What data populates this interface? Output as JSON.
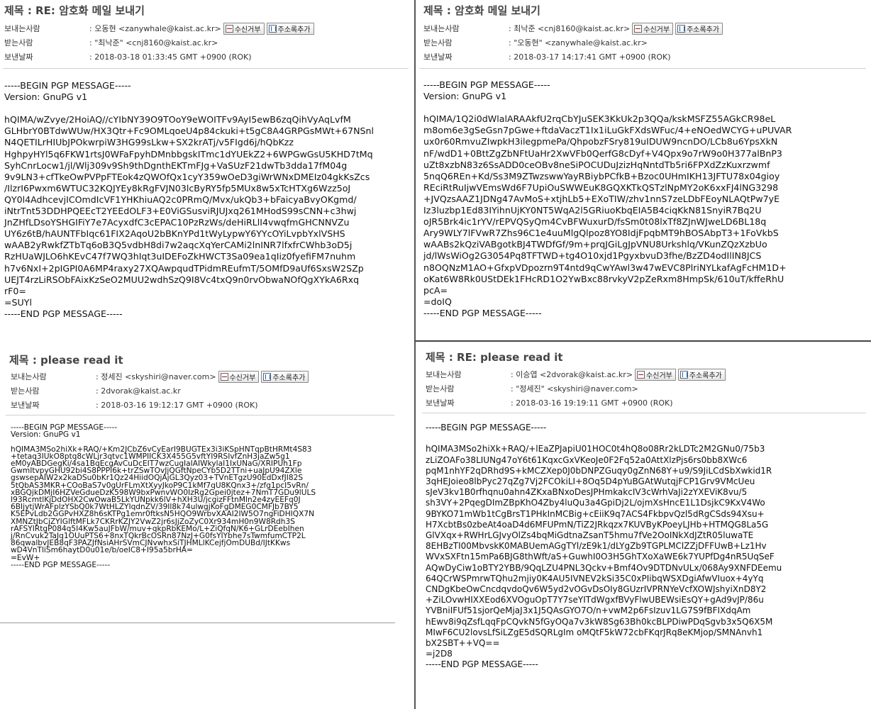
{
  "labels": {
    "subject": "제목 : ",
    "from": "보내는사람",
    "to": "받는사람",
    "date": "보낸날짜",
    "block_button": "수신거부",
    "addressbook_button": "주소록추가"
  },
  "messages": [
    {
      "subject": "RE: 암호화 메일 보내기",
      "from": ": 오동현 <zanywhale@kaist.ac.kr>",
      "to": ": \"최낙준\" <cnj8160@kaist.ac.kr>",
      "date": ": 2018-03-18 01:33:45 GMT +0900 (ROK)",
      "body": "-----BEGIN PGP MESSAGE-----\nVersion: GnuPG v1\n\nhQIMA/wZvye/2HoiAQ//cYIbNY39O9TOoY9eWOITFv9AyI5ewB6zqQihVyAqLvfM\nGLHbrY0BTdwWUw/HX3Qtr+Fc9OMLqoeU4p84ckuki+t5gC8A4GRPGsMWt+67NSnl\nN4QETILrHIUbJPOkwrpiW3HG99sLkw+SX2krATj/v5FIgd6j/hQbKzz\nHghpyHYl5q6FKW1rtsJ0WFaFpyhDMnbbgskITmc1dYUEkZ2+6WPGwGsU5KHD7tMq\nSyhCnrLocw1/jl/Wlj309v9Sh9thDgnthEKTmFJg+VaSUzF21dwTb3dda17fM04g\n9v9LN3+cfTkeOwPVPpFTEok4zQWOfQx1cyY359wOeD3giWrWNxDMEIz04gkKsZcs\n/IlzrI6Pwxm6WTUC32KQJYEy8kRgFVJN03lcByRY5fp5MUx8w5xTcHTXg6Wzz5oJ\nQY0l4AdhcevjICOmdIcVF1YHKhiuAQ2c0PRmQ/Mvx/ukQb3+bFaicyaBvyOKgmd/\niNtrTnt53DDHPQEEcT2YEEdOLF3+E0ViGSusviRJUJxq261MHodS99sCNN+c3hwj\nJnZHfLDsoYSHGIFiY7e7AcyxdfC3cEPAC10PzRzWs/deHiRLlI4vwqfmGHCNNVZu\nUY6z6tB/hAUNTFbIqc61FIX2AqoU2bBKnYPd1tWyLypwY6YYcOYiLvpbYxlVSHS\nwAAB2yRwkfZTbTq6oB3Q5vdbH8di7w2aqcXqYerCAMi2lnINR7lfxfrCWhb3oD5j\nRzHUaWJLO6hKEvC47f7WQ3hIqt3uIDEFoZkHWCT3Sa09ea1qIiz0fyefiFM7nuhm\nh7v6NxI+2pIGPI0A6MP4raxy27XQAwpqudTPidmREufmT/5OMfD9aUf6SxsW2SZp\nUEJT4rzLiRSObFAixKzSeO2MUU2wdhSzQ9I8Vc4txQ9n0rvObwaNOfQgXYkA6Rxq\nrF0=\n=SUYl\n-----END PGP MESSAGE-----"
    },
    {
      "subject": "암호화 메일 보내기",
      "from": ": 최낙준 <cnj8160@kaist.ac.kr>",
      "to": ": \"오동현\" <zanywhale@kaist.ac.kr>",
      "date": ": 2018-03-17 14:17:41 GMT +0900 (ROK)",
      "body": "-----BEGIN PGP MESSAGE-----\nVersion: GnuPG v1\n\nhQIMA/1Q2i0dWlalARAAkfU2rqCbYJuSEK3KkUk2p3QQa/kskMSFZ55AGkCR98eL\nm8om6e3gSeGsn7pGwe+ftdaVaczT1Ix1iLuGkFXdsWFuc/4+eNOedWCYG+uPUVAR\nux0r60RmvuZIwpkH3ilegpmePa/QhpobzFSry819uIDUW9ncnDO/LCb8u6YpsXkN\nnF/wdD1+0BttZgZbNFtUaHr2XwVFb0QerfG8cDyf+V4Qpx9o7rW9o0H377alBnP3\nuZt8xzbN83z6SsADD0ceOBv8neSiPOCUDuJzizHqNntdTb5ri6FPXdZzKuxrzwmf\n5nqQ6REn+Kd/Ss3M9ZTwzswwYayRBiybPCfkB+Bzoc0UHmIKH13JFTU78x04gioy\nREciRtRuIjwVEmsWd6F7UpiOuSWWEuK8GQXKTkQSTzlNpMY2oK6xxFJ4lNG3298\n+JVQzsAAZ1JDNg47AvMoS+xtjhLb5+EXoTIW/zhv1nnS7zeLDbFEoyNLAQtPw7yE\nIz3luzbp1Ed83IYihnUjKY0NT5WqA2l5GRiuoKbqEIA5B4ciqKkN81SnyiR7Bq2U\noJR5Brk4ic1rYV/rEPVQSyQm4CvBFWuxurD/fsSm0t08lxTf8ZJnWJweLD6BL18q\nAry9WLY7lFVwR7Zhs96C1e4uuMlgQlpoz8YO8IdjFpqbMT9hBOSAbpT3+1FoVkbS\nwAABs2kQziVABgotkBJ4TWDfGf/9m+prqJGiLgJpVNU8Urkshlq/VKunZQzXzbUo\njd/lWsWiOg2G3054Pq8TFTWD+tg4O10xjd1PgyxbvuD3fhe/BzZD4odIlIN8JCS\nn8OQNzM1AO+GfxpVDpozrn9T4ntd9qCwYAwl3w47wEVC8PlriNYLkafAgFcHM1D+\noKat6W8Rk0UStDEk1FHcRD1O2YwBxc88rvkyV2pZeRxm8HmpSk/610uT/kffeRhU\npcA=\n=doIQ\n-----END PGP MESSAGE-----"
    },
    {
      "subject": "please read it",
      "from": ": 정세진 <skyshiri@naver.com>",
      "to": ": 2dvorak@kaist.ac.kr",
      "date": ": 2018-03-16 19:12:17 GMT +0900 (ROK)",
      "body": "-----BEGIN PGP MESSAGE-----\nVersion: GnuPG v1\n\nhQIMA3MSo2hiXk+RAQ/+Km2JCbZ6vCyEarI9BUGTEx3i3iKSpHNTqpBtHRMt4S83\n+tetaq3IUkO8ptq8cWLjr3qtvc1WMPIICK3X455G5vftYI9RSIvfZnH3jaZw5g1\neM0yABDGegKi/4sa1BqEcgAvCuDcEIT7wzCugIaIAIWkylaI1IxUNaG/XRIPUh1Fp\nGwmItvpyGHU92bi4S8PPPI6k+trZSwTOvJjQGftNpeCYb5D2TTni+uaJpU94ZXle\ngswsepAIW2x2kaDSu0bKr1Qz24HiidOQjAjGL3Qyz03+TVnETgzU90EdDxfJI82S\n5tQbAS3MKR+COoBaS7v0gUrFLmXtXyyJkoP9C1kMf7qU8KQnx3+/zfg1pcI5vRn/\nxBGQjkDMjI6HZVeGdueDzK598W9bxPwnvWO0IzRg2Gpei0jtez+7NmT7GDu9lULS\nI93RcmtlKjDdOHX2CwOwaB5LkYUNpkk6lV+hXH3U/jcgizFFtnMln2e4zyEEFq0J\n6BIjytjWrAFplzYSbQ0k7WtHLZYIqdnZV/39Il8k74ulwgjKoFgDMEG0CMFJb7BY5\nK5EPvLdb2GGPvHXZ8h6sKTPg1emr0ftksN5HQO9WrbvXAAI2IW5O7ngFiDHIQX7N\nXMNZtJbCjZYIGlftMFLk7CKRrKZJY2VwZ2jr6sJjZoZyC0Xr934mH0n9W8Rdh3S\nrAFSYIRtgP084q5I4Kw5auJFbW/muv+qkpRbKEMo/L+ZiQfqN/K6+GLrDEebIhen\nj/RnCvuk2TaJq1OUuPTS6+8nxTQkrBcOSRn87NzJ+G0fsYIYbhe7sTwmfumCTP2L\n86qwalbvJEB8qF3PAZJfNsiAHrSVmCJNvwhxSiTJHMLlKCejfjOmDUBd/IJtKKws\nwD4VnTliSm6haytD0u01e/b/oeIC8+I95a5brHA=\n=EvW+\n-----END PGP MESSAGE-----"
    },
    {
      "subject": "RE: please read it",
      "from": ": 이승엽 <2dvorak@kaist.ac.kr>",
      "to": ": \"정세진\" <skyshiri@naver.com>",
      "date": ": 2018-03-16 19:19:11 GMT +0900 (ROK)",
      "body": "-----BEGIN PGP MESSAGE-----\n\nhQIMA3MSo2hiXk+RAQ/+lEaZPJapiU01HOC0t4hQ8o08Rr2kLDTc2M2GNu0/75b3\nzLiZOAFo38LIUNg47oY6t61KqxcGxVKeoJe0F2Fq52a0AttXlzPjs6rs0bb8XWc6\npqM1nhYF2qDRhd9S+kMCZXep0J0bDNPZGuqy0gZnN68Y+u9/S9JiLCdSbXwkid1R\n3qHEJoieo8lbPyc27qZg7Vj2FCOkiLI+8Oq5D4pYuBGAtWutqjFCP1Grv9VMcUeu\nsJeV3kv1B0rfhqnu0ahn4ZKxaBNxoDesJPHmkakcIV3cWrhVaJi2zYXEViK8vu/5\nsh3VY+2PqegDImZBpKhO4Zby4luQu3a4GpiDj2L/ojmXsHncE1L1DsjkC9KxV4Wo\n9BYKO71mWb1tCgBrsT1PHkInMCBig+cEiiK9q7ACS4FkbpvQzl5dRgCSds94Xsu+\nH7XcbtBs0zbeAt4oaD4d6MFUPmN/TiZ2JRkqzx7KUVByKPoeyLJHb+HTMQG8La5G\nGlVXqx+RWHrLGJvyOlZs4bqMiGdtnaZsanT5hmu7fVe2OoINkXdJZtR05luwaTE\n8EHBzTI00MbvskK0MABUemAGgTYl/zE9k1/dLYgZb9TGPLMClZZjDFFUwB+Lz1Hv\nWVxSXFtn15mPa6BJG8thWft/aS+GuwhI0O3H5GhTXoXaWE6k7YUPfDg4nR5UqSeF\nAQwDyCiw1oBTY2YBB/9QqLZU4PNL3Qckv+Bmf4Ov9DTDNvULx/068Ay9XNFDEemu\n64QCrWSPmrwTQhu2mjiy0K4AU5IVNEV2kSi35C0xPIibqWSXDgiAfwVIuox+4yYq\nCNDgKbeOwCncdqvdoQv6W5yd2vOGvDsOIy8GUzrIVPRNYeVcfXOWJshyiXnD8Y2\n+ZiLOvwHIXXEod6XVOguOpT7Y7seYITdWgxfBVyFlwUBEWsiEsQY+gAd9vJP/86u\nYVBniIFUf51sjorQeMjaJ3x1J5QAsGYO7O/n+vwM2p6FsIzuv1LG7S9fBFIXdqAm\nhEwv8i9qZsfLqqFpCQvkN5fGyOQa7v3kW8Sg63Bh0kcBLPDiwPDqSgvb3x5Q6X5M\nMIwF6CU2lovsLfSiLZgE5dSQRLgIm oMQtF5kW72cbFKqrJRq8eKMjop/SMNAnvh1\nbX2SBT++VQ==\n=j2D8\n-----END PGP MESSAGE-----"
    }
  ]
}
